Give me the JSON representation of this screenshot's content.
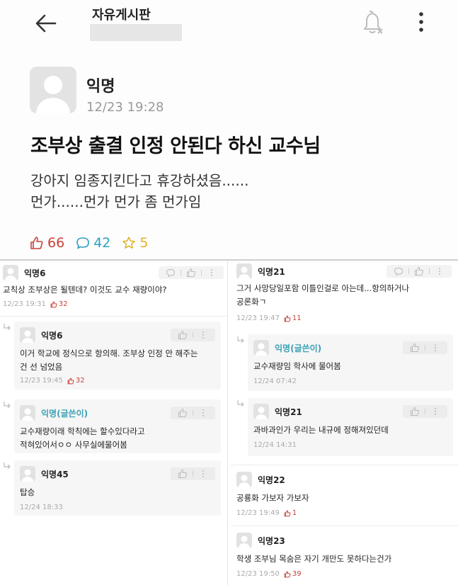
{
  "header": {
    "board_title": "자유게시판"
  },
  "post": {
    "author": "익명",
    "time": "12/23 19:28",
    "title": "조부상 출결 인정 안된다 하신 교수님",
    "body_lines": [
      "강아지 임종지킨다고 휴강하셨음......",
      "먼가......먼가 먼가 좀 먼가임"
    ],
    "likes": "66",
    "comments": "42",
    "scraps": "5"
  },
  "comments_left": [
    {
      "nick": "익명6",
      "text": [
        "교칙상 조부상은 될텐데? 이것도 교수 재량이야?"
      ],
      "time": "12/23 19:31",
      "likes": "32",
      "reply": false,
      "op": false
    },
    {
      "nick": "익명6",
      "text": [
        "이거 학교에 정식으로 항의해. 조부상 인정 안 해주는",
        "건 선 넘었음"
      ],
      "time": "12/23 19:45",
      "likes": "32",
      "reply": true,
      "op": false
    },
    {
      "nick": "익명(글쓴이)",
      "text": [
        "교수재량이래 학칙에는 할수있다라고",
        "적혀있어서ㅇㅇ 사무실에물어봄"
      ],
      "time": "",
      "likes": "",
      "reply": true,
      "op": true
    },
    {
      "nick": "익명45",
      "text": [
        "탑승"
      ],
      "time": "12/24 18:33",
      "likes": "",
      "reply": true,
      "op": false
    }
  ],
  "comments_right": [
    {
      "nick": "익명21",
      "text": [
        "그거 사망당일포함 이틀인걸로 아는데...항의하거나",
        "공론화ㄱ"
      ],
      "time": "12/23 19:47",
      "likes": "11",
      "reply": false,
      "op": false
    },
    {
      "nick": "익명(글쓴이)",
      "text": [
        "교수재량임 학사에 물어봄"
      ],
      "time": "12/24 07:42",
      "likes": "",
      "reply": true,
      "op": true
    },
    {
      "nick": "익명21",
      "text": [
        "과바과인가 우리는 내규에 정해져있던데"
      ],
      "time": "12/24 14:31",
      "likes": "",
      "reply": true,
      "op": false
    },
    {
      "nick": "익명22",
      "text": [
        "공룡화 가보자 가보자"
      ],
      "time": "12/23 19:49",
      "likes": "1",
      "reply": false,
      "op": false
    },
    {
      "nick": "익명23",
      "text": [
        "학생 조부님 목숨은 자기 개만도 못하다는건가"
      ],
      "time": "12/23 19:50",
      "likes": "39",
      "reply": false,
      "op": false
    }
  ],
  "colors": {
    "like": "#c8413a",
    "comment": "#2f9fc4",
    "scrap": "#e0b321",
    "op": "#3aa1b5"
  },
  "icons": [
    "back-arrow-icon",
    "bell-off-icon",
    "more-vertical-icon",
    "thumbs-up-icon",
    "comment-bubble-icon",
    "star-icon",
    "reply-arrow-icon"
  ]
}
